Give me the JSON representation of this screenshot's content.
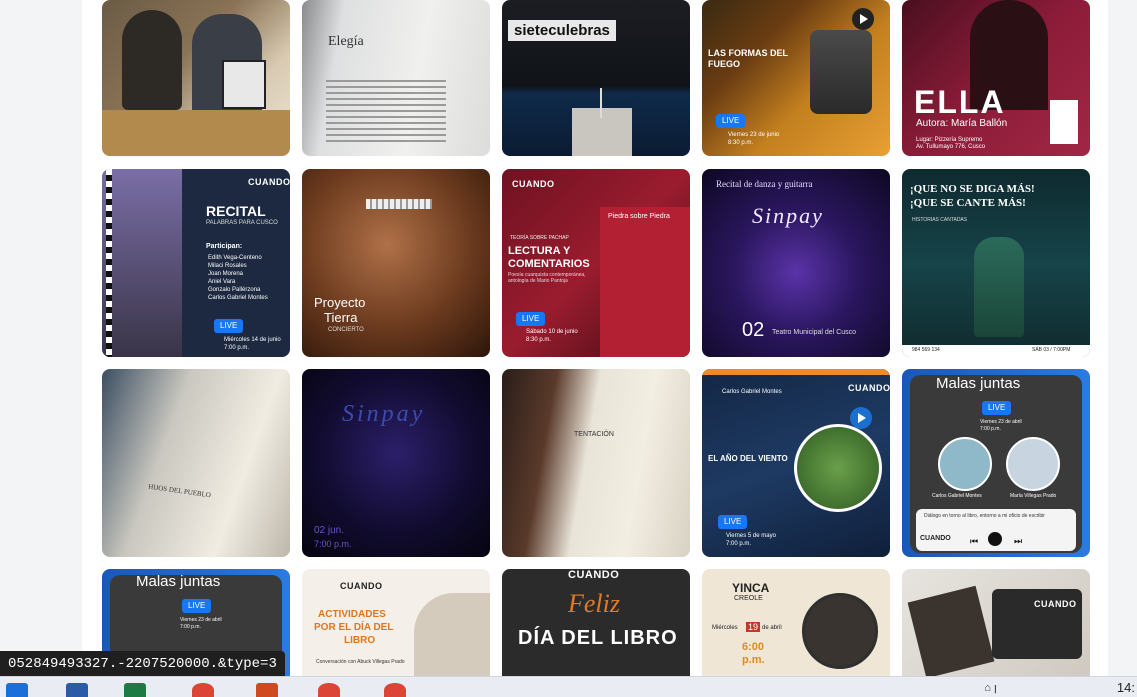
{
  "tiles": {
    "r1c2": {
      "title": "Elegía"
    },
    "r1c3": {
      "title": "sieteculebras"
    },
    "r1c4": {
      "title": "LAS FORMAS DEL FUEGO",
      "live": "LIVE",
      "date": "Viernes 23 de junio",
      "time": "8:30 p.m."
    },
    "r1c5": {
      "title": "ELLA",
      "author": "Autora: María Ballón",
      "place": "Lugar: Pizzería Supremo",
      "address": "Av. Tullumayo 776, Cusco"
    },
    "r2c1": {
      "logo": "CUANDO",
      "title": "RECITAL",
      "subtitle": "PALABRAS PARA CUSCO",
      "participants_label": "Participan:",
      "participants": [
        "Edith Vega-Centeno",
        "Milaci Rosales",
        "Joan Morena",
        "Aniel Vara",
        "Gonzalo Pallérzona",
        "Carlos Gabriel Montes"
      ],
      "live": "LIVE",
      "date": "Miércoles 14 de junio",
      "time": "7:00 p.m."
    },
    "r2c2": {
      "title": "Proyecto",
      "title2": "Tierra",
      "subtitle": "CONCIERTO"
    },
    "r2c3": {
      "logo": "CUANDO",
      "kicker": "TEORÍA SOBRE PACHAP",
      "title": "LECTURA Y",
      "title2": "COMENTARIOS",
      "subtitle": "Poesía cuarquista contemporánea, antología de Mario Pantoja",
      "book": "Piedra sobre Piedra",
      "live": "LIVE",
      "date": "Sábado 10 de junio",
      "time": "8:30 p.m."
    },
    "r2c4": {
      "header": "Recital de danza y guitarra",
      "title": "Sinpay",
      "day": "02",
      "venue": "Teatro Municipal del Cusco"
    },
    "r2c5": {
      "title": "¡QUE NO SE DIGA MÁS!",
      "title2": "¡QUE SE CANTE MÁS!",
      "subtitle": "HISTORIAS CANTADAS",
      "phone": "984 569 134",
      "when": "SÁB 03 / 7:00PM"
    },
    "r3c1": {
      "heading": "HIJOS DEL PUEBLO"
    },
    "r3c2": {
      "title": "Sinpay",
      "date": "02 jun.",
      "time": "7:00 p.m."
    },
    "r3c3": {
      "heading": "TENTACIÓN"
    },
    "r3c4": {
      "logo": "CUANDO",
      "guest": "Carlos Gabriel Montes",
      "title": "EL AÑO DEL VIENTO",
      "live": "LIVE",
      "date": "Viernes 5 de mayo",
      "time": "7:00 p.m."
    },
    "r3c5": {
      "title": "Malas juntas",
      "live": "LIVE",
      "date": "Viernes 23 de abril",
      "time": "7:00 p.m.",
      "name1": "Carlos Gabriel Montes",
      "name2": "María Villegas Prado",
      "caption": "Diálogo en torno al libro, entorno a mi oficio de escribir",
      "logo": "CUANDO"
    },
    "r4c1": {
      "title": "Malas juntas",
      "live": "LIVE",
      "date": "Viernes 23 de abril",
      "time": "7:00 p.m."
    },
    "r4c2": {
      "logo": "CUANDO",
      "title": "ACTIVIDADES",
      "title2": "POR EL DÍA DEL",
      "title3": "LIBRO",
      "caption": "Conversación con Abuck Villegas Prado"
    },
    "r4c3": {
      "logo": "CUANDO",
      "title": "Feliz",
      "title2": "DÍA DEL LIBRO"
    },
    "r4c4": {
      "brand": "YINCA",
      "brand2": "CREOLE",
      "date_prefix": "Miércoles",
      "day": "19",
      "date_suffix": "de abril",
      "time": "6:00",
      "time2": "p.m."
    },
    "r4c5": {
      "logo": "CUANDO"
    }
  },
  "status_url": "052849493327.-2207520000.&type=3",
  "clock": "14:",
  "tray_label": "⌂ ꞁ"
}
